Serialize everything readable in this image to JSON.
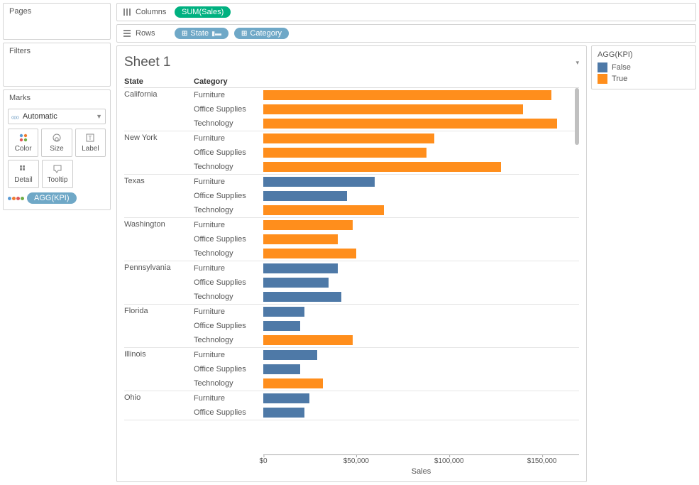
{
  "sidebar": {
    "pages_title": "Pages",
    "filters_title": "Filters",
    "marks_title": "Marks",
    "marks_type": "Automatic",
    "buttons": {
      "color": "Color",
      "size": "Size",
      "label": "Label",
      "detail": "Detail",
      "tooltip": "Tooltip"
    },
    "color_pill": "AGG(KPI)"
  },
  "shelves": {
    "columns_label": "Columns",
    "rows_label": "Rows",
    "columns_pill": "SUM(Sales)",
    "rows_pill_1": "State",
    "rows_pill_2": "Category"
  },
  "sheet": {
    "title": "Sheet 1",
    "header_state": "State",
    "header_category": "Category",
    "x_axis_label": "Sales"
  },
  "legend": {
    "title": "AGG(KPI)",
    "false_label": "False",
    "true_label": "True",
    "false_color": "#4e79a7",
    "true_color": "#ff8e1c"
  },
  "chart_data": {
    "type": "bar",
    "xlabel": "Sales",
    "ylabel": "",
    "xlim": [
      0,
      170000
    ],
    "x_ticks": [
      0,
      50000,
      100000,
      150000
    ],
    "x_tick_labels": [
      "$0",
      "$50,000",
      "$100,000",
      "$150,000"
    ],
    "color_field": "AGG(KPI)",
    "color_domain": [
      "False",
      "True"
    ],
    "color_range": [
      "#4e79a7",
      "#ff8e1c"
    ],
    "data": [
      {
        "state": "California",
        "rows": [
          {
            "category": "Furniture",
            "value": 155000,
            "kpi": "True"
          },
          {
            "category": "Office Supplies",
            "value": 140000,
            "kpi": "True"
          },
          {
            "category": "Technology",
            "value": 158000,
            "kpi": "True"
          }
        ]
      },
      {
        "state": "New York",
        "rows": [
          {
            "category": "Furniture",
            "value": 92000,
            "kpi": "True"
          },
          {
            "category": "Office Supplies",
            "value": 88000,
            "kpi": "True"
          },
          {
            "category": "Technology",
            "value": 128000,
            "kpi": "True"
          }
        ]
      },
      {
        "state": "Texas",
        "rows": [
          {
            "category": "Furniture",
            "value": 60000,
            "kpi": "False"
          },
          {
            "category": "Office Supplies",
            "value": 45000,
            "kpi": "False"
          },
          {
            "category": "Technology",
            "value": 65000,
            "kpi": "True"
          }
        ]
      },
      {
        "state": "Washington",
        "rows": [
          {
            "category": "Furniture",
            "value": 48000,
            "kpi": "True"
          },
          {
            "category": "Office Supplies",
            "value": 40000,
            "kpi": "True"
          },
          {
            "category": "Technology",
            "value": 50000,
            "kpi": "True"
          }
        ]
      },
      {
        "state": "Pennsylvania",
        "rows": [
          {
            "category": "Furniture",
            "value": 40000,
            "kpi": "False"
          },
          {
            "category": "Office Supplies",
            "value": 35000,
            "kpi": "False"
          },
          {
            "category": "Technology",
            "value": 42000,
            "kpi": "False"
          }
        ]
      },
      {
        "state": "Florida",
        "rows": [
          {
            "category": "Furniture",
            "value": 22000,
            "kpi": "False"
          },
          {
            "category": "Office Supplies",
            "value": 20000,
            "kpi": "False"
          },
          {
            "category": "Technology",
            "value": 48000,
            "kpi": "True"
          }
        ]
      },
      {
        "state": "Illinois",
        "rows": [
          {
            "category": "Furniture",
            "value": 29000,
            "kpi": "False"
          },
          {
            "category": "Office Supplies",
            "value": 20000,
            "kpi": "False"
          },
          {
            "category": "Technology",
            "value": 32000,
            "kpi": "True"
          }
        ]
      },
      {
        "state": "Ohio",
        "rows": [
          {
            "category": "Furniture",
            "value": 25000,
            "kpi": "False"
          },
          {
            "category": "Office Supplies",
            "value": 22000,
            "kpi": "False"
          }
        ]
      }
    ]
  }
}
